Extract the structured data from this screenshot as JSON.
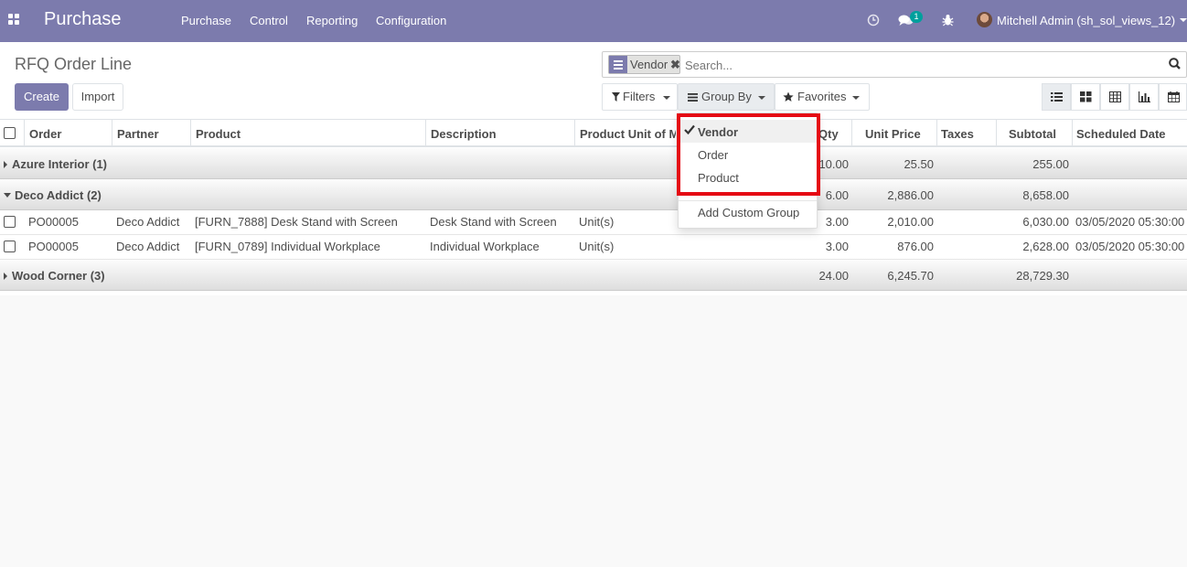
{
  "navbar": {
    "app_name": "Purchase",
    "menu": [
      "Purchase",
      "Control",
      "Reporting",
      "Configuration"
    ],
    "messages_badge": "1",
    "user": "Mitchell Admin (sh_sol_views_12)"
  },
  "control_panel": {
    "breadcrumb": "RFQ Order Line",
    "create_label": "Create",
    "import_label": "Import",
    "facet_label": "Vendor",
    "search_placeholder": "Search...",
    "filters_label": "Filters",
    "groupby_label": "Group By",
    "favorites_label": "Favorites"
  },
  "table": {
    "columns": [
      "Order",
      "Partner",
      "Product",
      "Description",
      "Product Unit of M",
      "Qty",
      "Unit Price",
      "Taxes",
      "Subtotal",
      "Scheduled Date"
    ],
    "groups": [
      {
        "name": "Azure Interior (1)",
        "qty": "10.00",
        "unit_price": "25.50",
        "subtotal": "255.00"
      },
      {
        "name": "Deco Addict (2)",
        "qty": "6.00",
        "unit_price": "2,886.00",
        "subtotal": "8,658.00"
      },
      {
        "name": "Wood Corner (3)",
        "qty": "24.00",
        "unit_price": "6,245.70",
        "subtotal": "28,729.30"
      }
    ],
    "rows": [
      {
        "order": "PO00005",
        "partner": "Deco Addict",
        "product": "[FURN_7888] Desk Stand with Screen",
        "description": "Desk Stand with Screen",
        "uom": "Unit(s)",
        "qty": "3.00",
        "unit_price": "2,010.00",
        "subtotal": "6,030.00",
        "date": "03/05/2020 05:30:00"
      },
      {
        "order": "PO00005",
        "partner": "Deco Addict",
        "product": "[FURN_0789] Individual Workplace",
        "description": "Individual Workplace",
        "uom": "Unit(s)",
        "qty": "3.00",
        "unit_price": "876.00",
        "subtotal": "2,628.00",
        "date": "03/05/2020 05:30:00"
      }
    ]
  },
  "groupby_dropdown": {
    "items": [
      "Vendor",
      "Order",
      "Product"
    ],
    "selected": "Vendor",
    "custom_label": "Add Custom Group"
  },
  "colors": {
    "brand": "#7c7bad",
    "highlight": "#e50914",
    "badge": "#00a09d"
  }
}
